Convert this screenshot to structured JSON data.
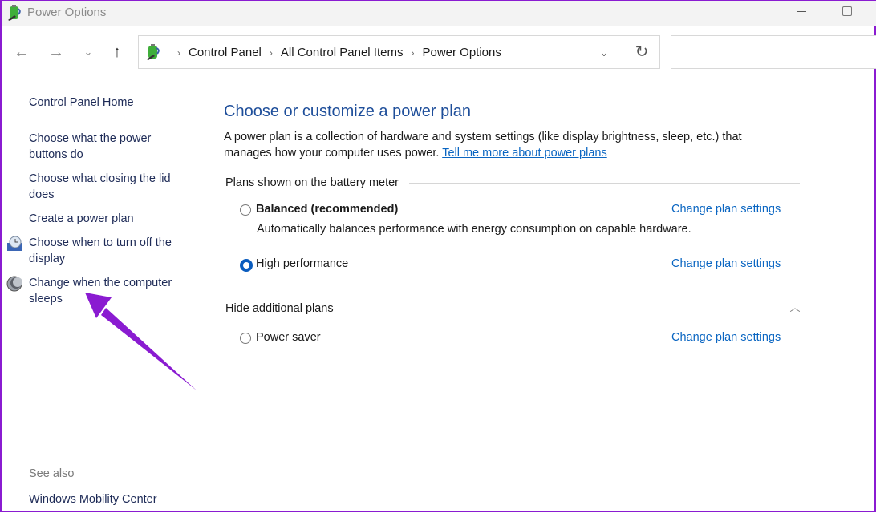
{
  "window": {
    "title": "Power Options",
    "app_icon": "battery-power-icon",
    "controls": {
      "minimize": "minimize-icon",
      "maximize": "maximize-icon"
    }
  },
  "navigation": {
    "back_icon": "←",
    "forward_icon": "→",
    "recent_icon": "⌄",
    "up_icon": "↑",
    "refresh_icon": "↻",
    "dropdown_icon": "⌄"
  },
  "breadcrumb": {
    "separator": "›",
    "items": [
      "Control Panel",
      "All Control Panel Items",
      "Power Options"
    ]
  },
  "search": {
    "placeholder": "",
    "value": ""
  },
  "sidebar": {
    "home": "Control Panel Home",
    "links": [
      {
        "label": "Choose what the power buttons do",
        "icon": null
      },
      {
        "label": "Choose what closing the lid does",
        "icon": null
      },
      {
        "label": "Create a power plan",
        "icon": null
      },
      {
        "label": "Choose when to turn off the display",
        "icon": "display-clock-icon"
      },
      {
        "label": "Change when the computer sleeps",
        "icon": "sleep-moon-icon"
      }
    ],
    "see_also_label": "See also",
    "see_also_links": [
      "Windows Mobility Center"
    ]
  },
  "main": {
    "title": "Choose or customize a power plan",
    "description": "A power plan is a collection of hardware and system settings (like display brightness, sleep, etc.) that manages how your computer uses power.",
    "learn_more_link": "Tell me more about power plans",
    "battery_meter_group": {
      "label": "Plans shown on the battery meter",
      "plans": [
        {
          "name": "Balanced (recommended)",
          "selected": false,
          "bold": true,
          "description": "Automatically balances performance with energy consumption on capable hardware.",
          "link": "Change plan settings"
        },
        {
          "name": "High performance",
          "selected": true,
          "bold": false,
          "description": "",
          "link": "Change plan settings"
        }
      ]
    },
    "additional_group": {
      "label": "Hide additional plans",
      "toggle_icon": "︿",
      "plans": [
        {
          "name": "Power saver",
          "selected": false,
          "link": "Change plan settings"
        }
      ]
    }
  },
  "annotation": {
    "type": "arrow",
    "color": "#8a1bd1",
    "points_to": "Change when the computer sleeps"
  }
}
